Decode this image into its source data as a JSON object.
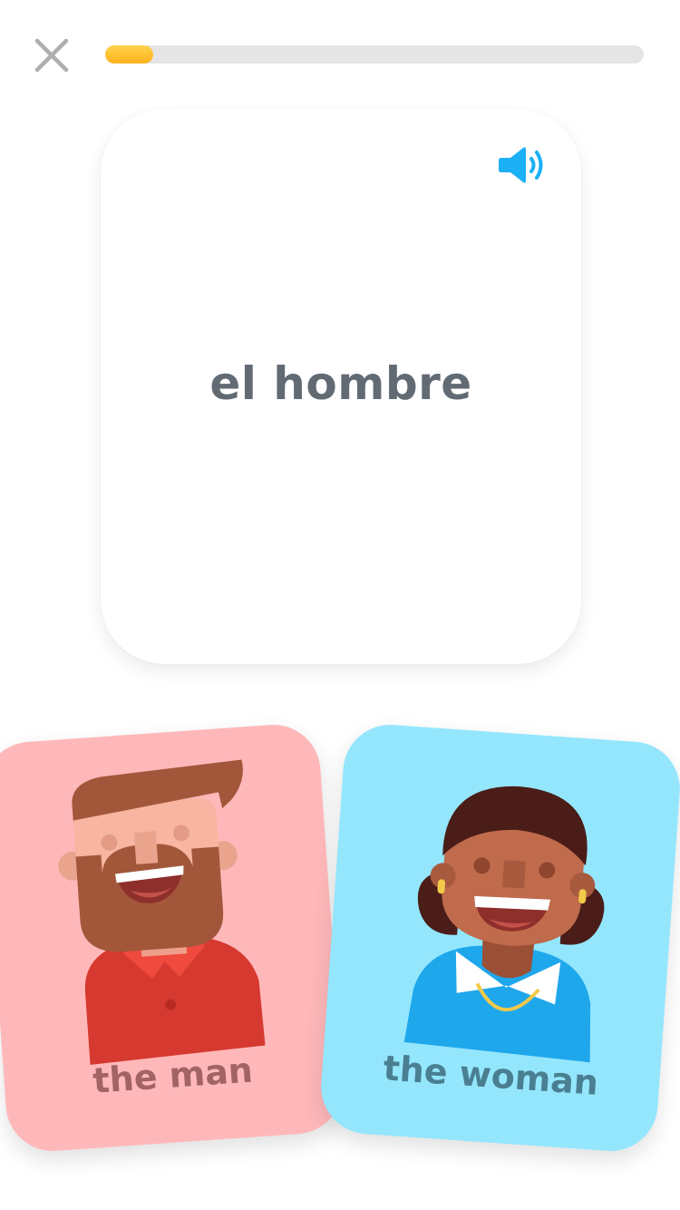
{
  "header": {
    "close_icon": "close-icon",
    "progress_fraction": 0.09
  },
  "prompt": {
    "speaker_icon": "speaker-icon",
    "word": "el hombre"
  },
  "choices": [
    {
      "label": "the man",
      "illustration": "man-illustration",
      "background": "#ffb8ba"
    },
    {
      "label": "the woman",
      "illustration": "woman-illustration",
      "background": "#94e6fd"
    }
  ],
  "colors": {
    "accent_blue": "#1cb0f6",
    "progress_yellow": "#ffc32a",
    "track_gray": "#e5e5e5",
    "text_gray": "#626a73"
  }
}
